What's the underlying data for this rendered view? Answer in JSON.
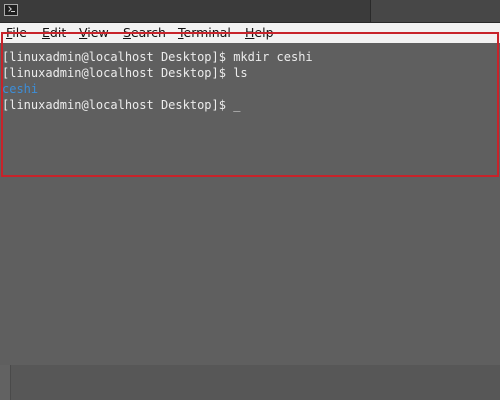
{
  "menu": {
    "file": "File",
    "edit": "Edit",
    "view": "View",
    "search": "Search",
    "terminal": "Terminal",
    "help": "Help"
  },
  "terminal": {
    "lines": [
      "[linuxadmin@localhost Desktop]$ mkdir ceshi",
      "[linuxadmin@localhost Desktop]$ ls",
      "ceshi",
      "[linuxadmin@localhost Desktop]$ "
    ],
    "cursor": "_",
    "directory_color": "#3d8ed8",
    "text_color": "#ececec",
    "background_color": "#5f5f5f"
  },
  "annotation": {
    "highlight_color": "#c8232a"
  },
  "icons": {
    "app_icon": "terminal-icon"
  }
}
